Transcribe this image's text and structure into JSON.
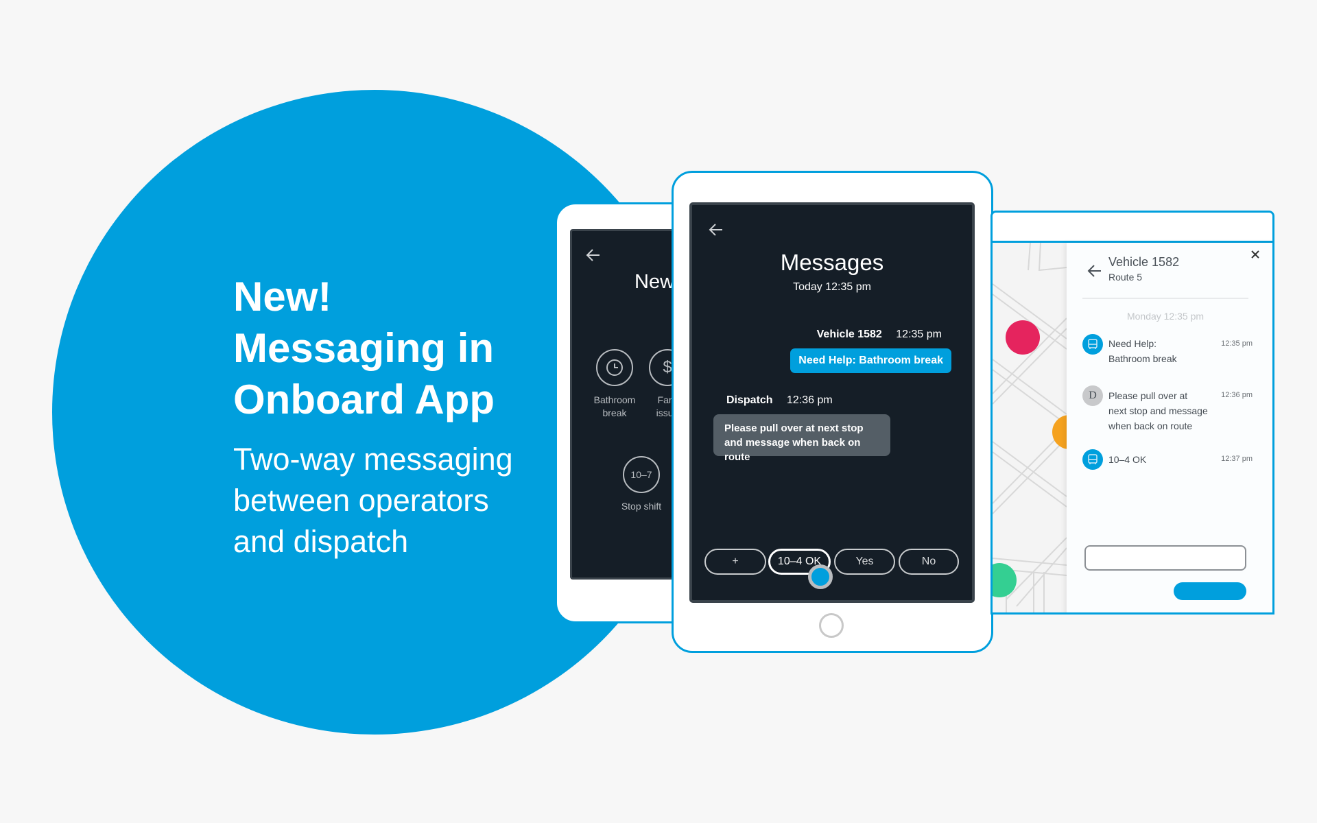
{
  "hero": {
    "headline_lines": [
      "New!",
      "Messaging in",
      "Onboard App"
    ],
    "subhead_lines": [
      "Two-way messaging",
      "between operators",
      "and dispatch"
    ]
  },
  "colors": {
    "brand": "#009fdd",
    "screen": "#151e27",
    "dispatch_bubble": "#545e66",
    "pink": "#e5245e",
    "orange": "#f5a21f",
    "green": "#34cf92"
  },
  "back_tablet": {
    "title": "New",
    "actions": [
      {
        "label_lines": [
          "Bathroom",
          "break"
        ],
        "icon": "clock-icon"
      },
      {
        "label_lines": [
          "Fare",
          "issue"
        ],
        "icon": "dollar-icon",
        "icon_text": "$"
      },
      {
        "label_lines": [
          "Stop shift"
        ],
        "icon_text": "10–7"
      }
    ]
  },
  "messages_screen": {
    "title": "Messages",
    "subtitle": "Today 12:35 pm",
    "outgoing": {
      "sender": "Vehicle 1582",
      "time": "12:35 pm",
      "text": "Need Help: Bathroom break"
    },
    "incoming": {
      "sender": "Dispatch",
      "time": "12:36 pm",
      "text_lines": [
        "Please pull over at next stop",
        "and message when back on route"
      ]
    },
    "quick_replies": [
      "+",
      "10–4 OK",
      "Yes",
      "No"
    ]
  },
  "dispatch_panel": {
    "title": "Vehicle 1582",
    "subtitle": "Route 5",
    "date": "Monday 12:35 pm",
    "messages": [
      {
        "from": "vehicle",
        "icon": "bus-icon",
        "text_lines": [
          "Need Help:",
          "Bathroom break"
        ],
        "time": "12:35 pm"
      },
      {
        "from": "dispatch",
        "avatar": "D",
        "text_lines": [
          "Please pull over at",
          "next stop and message",
          "when back on route"
        ],
        "time": "12:36 pm"
      },
      {
        "from": "vehicle",
        "icon": "bus-icon",
        "text_lines": [
          "10–4 OK"
        ],
        "time": "12:37 pm"
      }
    ],
    "input_value": ""
  }
}
